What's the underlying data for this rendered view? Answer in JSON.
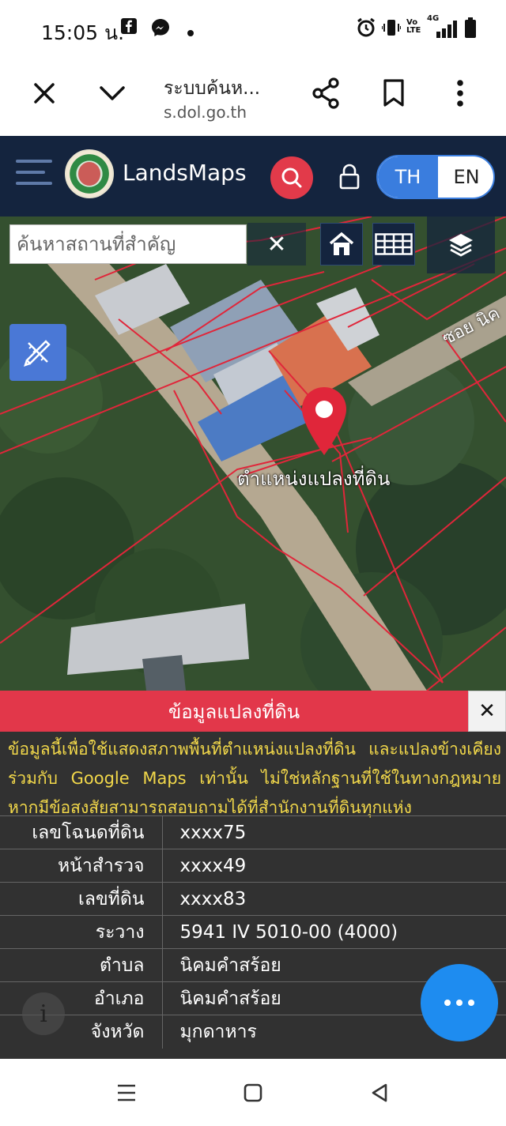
{
  "status_bar": {
    "time": "15:05 น.",
    "volte_label": "Vo LTE",
    "network_label": "4G"
  },
  "browser": {
    "title": "ระบบค้นห...",
    "url": "s.dol.go.th"
  },
  "header": {
    "brand": "LandsMaps",
    "lang_th": "TH",
    "lang_en": "EN",
    "accent_color": "#e23a4a",
    "lang_active_color": "#3a7dde"
  },
  "map": {
    "search_placeholder": "ค้นหาสถานที่สำคัญ",
    "clear_label": "✕",
    "pin_label": "ตำแหน่งแปลงที่ดิน",
    "road_label": "ซอย นิค",
    "pin_color": "#e0263a",
    "parcel_line_color": "#e0263a"
  },
  "panel": {
    "title": "ข้อมูลแปลงที่ดิน",
    "close_label": "✕",
    "notice": "ข้อมูลนี้เพื่อใช้แสดงสภาพพื้นที่ตำแหน่งแปลงที่ดิน และแปลงข้างเคียงร่วมกับ Google Maps เท่านั้น ไม่ใช่หลักฐานที่ใช้ในทางกฎหมาย หากมีข้อสงสัยสามารถสอบถามได้ที่สำนักงานที่ดินทุกแห่ง",
    "rows": [
      {
        "key": "เลขโฉนดที่ดิน",
        "value": "xxxx75"
      },
      {
        "key": "หน้าสำรวจ",
        "value": "xxxx49"
      },
      {
        "key": "เลขที่ดิน",
        "value": "xxxx83"
      },
      {
        "key": "ระวาง",
        "value": "5941 IV 5010-00 (4000)"
      },
      {
        "key": "ตำบล",
        "value": "นิคมคำสร้อย"
      },
      {
        "key": "อำเภอ",
        "value": "นิคมคำสร้อย"
      },
      {
        "key": "จังหวัด",
        "value": "มุกดาหาร"
      }
    ],
    "info_icon": "i"
  }
}
